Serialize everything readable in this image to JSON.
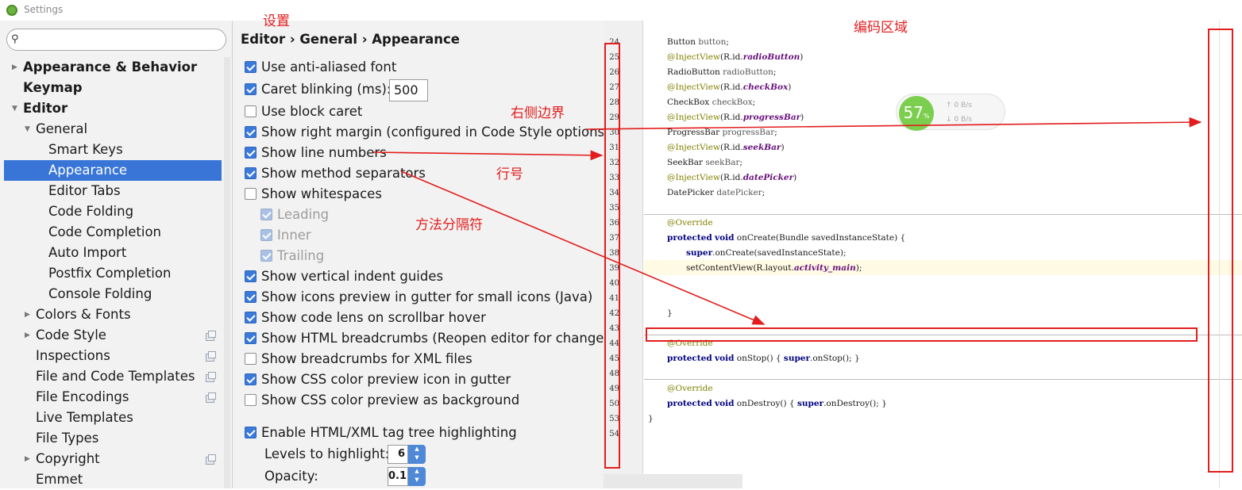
{
  "window": {
    "title": "Settings"
  },
  "search": {
    "placeholder": "",
    "icon": "search-icon"
  },
  "sidebar": {
    "items": [
      {
        "label": "Appearance & Behavior",
        "arrow": "▶"
      },
      {
        "label": "Keymap"
      },
      {
        "label": "Editor",
        "arrow": "▼"
      },
      {
        "label": "General",
        "arrow": "▼"
      },
      {
        "label": "Smart Keys"
      },
      {
        "label": "Appearance",
        "selected": true
      },
      {
        "label": "Editor Tabs"
      },
      {
        "label": "Code Folding"
      },
      {
        "label": "Code Completion"
      },
      {
        "label": "Auto Import"
      },
      {
        "label": "Postfix Completion"
      },
      {
        "label": "Console Folding"
      },
      {
        "label": "Colors & Fonts",
        "arrow": "▶"
      },
      {
        "label": "Code Style",
        "arrow": "▶",
        "project_icon": true
      },
      {
        "label": "Inspections",
        "project_icon": true
      },
      {
        "label": "File and Code Templates",
        "project_icon": true
      },
      {
        "label": "File Encodings",
        "project_icon": true
      },
      {
        "label": "Live Templates"
      },
      {
        "label": "File Types"
      },
      {
        "label": "Copyright",
        "arrow": "▶",
        "project_icon": true
      },
      {
        "label": "Emmet"
      }
    ]
  },
  "panel": {
    "breadcrumb": "Editor › General › Appearance",
    "options": [
      {
        "label": "Use anti-aliased font",
        "checked": true
      },
      {
        "label": "Caret blinking (ms):",
        "checked": true
      },
      {
        "label": "Use block caret",
        "checked": false
      },
      {
        "label": "Show right margin (configured in Code Style options)",
        "checked": true
      },
      {
        "label": "Show line numbers",
        "checked": true
      },
      {
        "label": "Show method separators",
        "checked": true
      },
      {
        "label": "Show whitespaces",
        "checked": false
      },
      {
        "label": "Leading",
        "checked": true,
        "disabled": true
      },
      {
        "label": "Inner",
        "checked": true,
        "disabled": true
      },
      {
        "label": "Trailing",
        "checked": true,
        "disabled": true
      },
      {
        "label": "Show vertical indent guides",
        "checked": true
      },
      {
        "label": "Show icons preview in gutter for small icons (Java)",
        "checked": true
      },
      {
        "label": "Show code lens on scrollbar hover",
        "checked": true
      },
      {
        "label": "Show HTML breadcrumbs (Reopen editor for changes to",
        "checked": true
      },
      {
        "label": "Show breadcrumbs for XML files",
        "checked": false
      },
      {
        "label": "Show CSS color preview icon in gutter",
        "checked": true
      },
      {
        "label": "Show CSS color preview as background",
        "checked": false
      },
      {
        "label": "Enable HTML/XML tag tree highlighting",
        "checked": true
      }
    ],
    "caret_blink_ms": "500",
    "levels_label": "Levels to highlight:",
    "levels_value": "6",
    "opacity_label": "Opacity:",
    "opacity_value": "0.1"
  },
  "editor": {
    "line_numbers": [
      "24",
      "25",
      "26",
      "27",
      "28",
      "29",
      "30",
      "31",
      "32",
      "33",
      "34",
      "35",
      "36",
      "37",
      "38",
      "39",
      "40",
      "41",
      "42",
      "43",
      "44",
      "45",
      "48",
      "49",
      "50",
      "53",
      "54"
    ],
    "code_lines": [
      {
        "ln": "24",
        "text": "Button button;"
      },
      {
        "ln": "25",
        "text": "@InjectView(R.id.radioButton)"
      },
      {
        "ln": "26",
        "text": "RadioButton radioButton;"
      },
      {
        "ln": "27",
        "text": "@InjectView(R.id.checkBox)"
      },
      {
        "ln": "28",
        "text": "CheckBox checkBox;"
      },
      {
        "ln": "29",
        "text": "@InjectView(R.id.progressBar)"
      },
      {
        "ln": "30",
        "text": "ProgressBar progressBar;"
      },
      {
        "ln": "31",
        "text": "@InjectView(R.id.seekBar)"
      },
      {
        "ln": "32",
        "text": "SeekBar seekBar;"
      },
      {
        "ln": "33",
        "text": "@InjectView(R.id.datePicker)"
      },
      {
        "ln": "34",
        "text": "DatePicker datePicker;"
      },
      {
        "ln": "36",
        "text": "@Override"
      },
      {
        "ln": "37",
        "text": "protected void onCreate(Bundle savedInstanceState) {"
      },
      {
        "ln": "38",
        "text": "super.onCreate(savedInstanceState);"
      },
      {
        "ln": "39",
        "text": "setContentView(R.layout.activity_main);"
      },
      {
        "ln": "42",
        "text": "}"
      },
      {
        "ln": "44",
        "text": "@Override"
      },
      {
        "ln": "45",
        "text": "protected void onStop() { super.onStop(); }"
      },
      {
        "ln": "49",
        "text": "@Override"
      },
      {
        "ln": "50",
        "text": "protected void onDestroy() { super.onDestroy(); }"
      },
      {
        "ln": "53",
        "text": "}"
      }
    ]
  },
  "widget": {
    "percent": "57",
    "percent_sign": "%",
    "up": "0 B/s",
    "down": "0 B/s"
  },
  "annotations": {
    "settings": "设置",
    "code_area": "编码区域",
    "right_margin": "右侧边界",
    "line_numbers": "行号",
    "method_separator": "方法分隔符",
    "color": "#e31d1d"
  }
}
